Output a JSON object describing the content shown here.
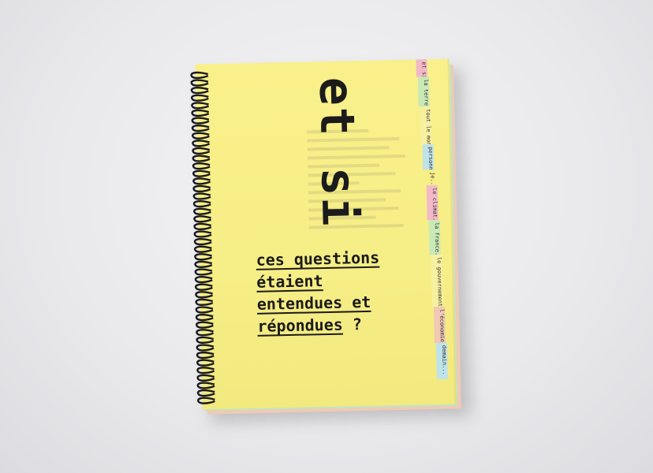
{
  "cover": {
    "title": "et si",
    "subtitle_lines": [
      "ces questions",
      "étaient",
      "entendues et",
      "répondues"
    ],
    "question_mark": "?"
  },
  "tabs": [
    {
      "label": "et si...",
      "color": "#f3b9c7"
    },
    {
      "label": "la terre...",
      "color": "#c9e9b7"
    },
    {
      "label": "tout le monde...",
      "color": "#f7f0a0"
    },
    {
      "label": "personne...",
      "color": "#bfe3ea"
    },
    {
      "label": "je...",
      "color": "#f6ee86"
    },
    {
      "label": "le climat...",
      "color": "#f3b9c7"
    },
    {
      "label": "la france...",
      "color": "#c9e9b7"
    },
    {
      "label": "le gouvernement...",
      "color": "#f7f0a0"
    },
    {
      "label": "l'économie...",
      "color": "#f1c9b4"
    },
    {
      "label": "demain...",
      "color": "#bfe3ea"
    }
  ],
  "colors": {
    "cover": "#f6ee86",
    "text": "#1b1b1b",
    "background": "#ececef"
  }
}
